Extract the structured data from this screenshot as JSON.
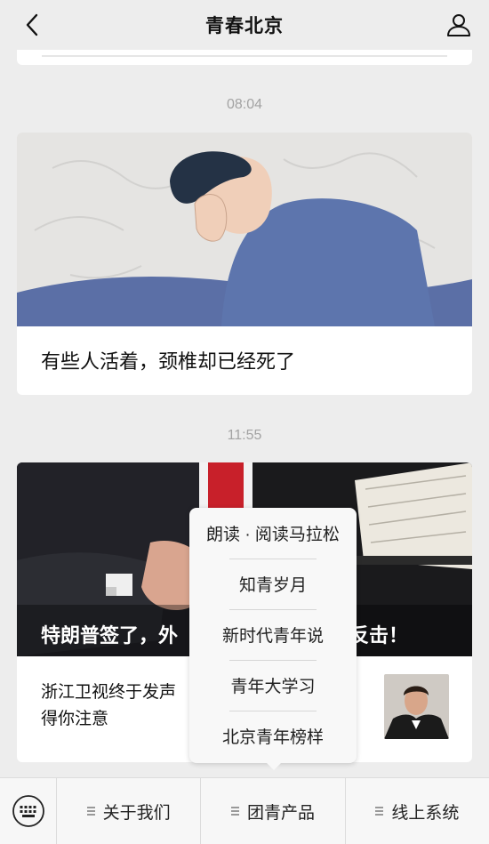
{
  "header": {
    "title": "青春北京",
    "back_icon": "chevron-left-icon",
    "profile_icon": "person-icon"
  },
  "messages": [
    {
      "time": "08:04",
      "title": "有些人活着，颈椎却已经死了"
    },
    {
      "time": "11:55",
      "overlay_title": "特朗普签了，外",
      "overlay_title_tail": "反击！",
      "sub_title": "浙江卫视终于发声",
      "sub_title_line2": "得你注意"
    }
  ],
  "popup_menu": {
    "items": [
      "朗读 · 阅读马拉松",
      "知青岁月",
      "新时代青年说",
      "青年大学习",
      "北京青年榜样"
    ]
  },
  "bottom_bar": {
    "keyboard_icon": "keyboard-icon",
    "tabs": [
      "关于我们",
      "团青产品",
      "线上系统"
    ]
  }
}
